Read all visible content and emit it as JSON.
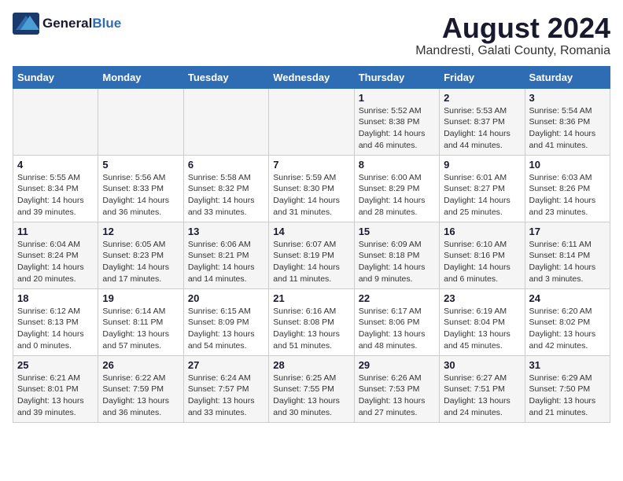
{
  "logo": {
    "general": "General",
    "blue": "Blue"
  },
  "title": "August 2024",
  "subtitle": "Mandresti, Galati County, Romania",
  "days_of_week": [
    "Sunday",
    "Monday",
    "Tuesday",
    "Wednesday",
    "Thursday",
    "Friday",
    "Saturday"
  ],
  "weeks": [
    [
      {
        "day": "",
        "info": ""
      },
      {
        "day": "",
        "info": ""
      },
      {
        "day": "",
        "info": ""
      },
      {
        "day": "",
        "info": ""
      },
      {
        "day": "1",
        "info": "Sunrise: 5:52 AM\nSunset: 8:38 PM\nDaylight: 14 hours and 46 minutes."
      },
      {
        "day": "2",
        "info": "Sunrise: 5:53 AM\nSunset: 8:37 PM\nDaylight: 14 hours and 44 minutes."
      },
      {
        "day": "3",
        "info": "Sunrise: 5:54 AM\nSunset: 8:36 PM\nDaylight: 14 hours and 41 minutes."
      }
    ],
    [
      {
        "day": "4",
        "info": "Sunrise: 5:55 AM\nSunset: 8:34 PM\nDaylight: 14 hours and 39 minutes."
      },
      {
        "day": "5",
        "info": "Sunrise: 5:56 AM\nSunset: 8:33 PM\nDaylight: 14 hours and 36 minutes."
      },
      {
        "day": "6",
        "info": "Sunrise: 5:58 AM\nSunset: 8:32 PM\nDaylight: 14 hours and 33 minutes."
      },
      {
        "day": "7",
        "info": "Sunrise: 5:59 AM\nSunset: 8:30 PM\nDaylight: 14 hours and 31 minutes."
      },
      {
        "day": "8",
        "info": "Sunrise: 6:00 AM\nSunset: 8:29 PM\nDaylight: 14 hours and 28 minutes."
      },
      {
        "day": "9",
        "info": "Sunrise: 6:01 AM\nSunset: 8:27 PM\nDaylight: 14 hours and 25 minutes."
      },
      {
        "day": "10",
        "info": "Sunrise: 6:03 AM\nSunset: 8:26 PM\nDaylight: 14 hours and 23 minutes."
      }
    ],
    [
      {
        "day": "11",
        "info": "Sunrise: 6:04 AM\nSunset: 8:24 PM\nDaylight: 14 hours and 20 minutes."
      },
      {
        "day": "12",
        "info": "Sunrise: 6:05 AM\nSunset: 8:23 PM\nDaylight: 14 hours and 17 minutes."
      },
      {
        "day": "13",
        "info": "Sunrise: 6:06 AM\nSunset: 8:21 PM\nDaylight: 14 hours and 14 minutes."
      },
      {
        "day": "14",
        "info": "Sunrise: 6:07 AM\nSunset: 8:19 PM\nDaylight: 14 hours and 11 minutes."
      },
      {
        "day": "15",
        "info": "Sunrise: 6:09 AM\nSunset: 8:18 PM\nDaylight: 14 hours and 9 minutes."
      },
      {
        "day": "16",
        "info": "Sunrise: 6:10 AM\nSunset: 8:16 PM\nDaylight: 14 hours and 6 minutes."
      },
      {
        "day": "17",
        "info": "Sunrise: 6:11 AM\nSunset: 8:14 PM\nDaylight: 14 hours and 3 minutes."
      }
    ],
    [
      {
        "day": "18",
        "info": "Sunrise: 6:12 AM\nSunset: 8:13 PM\nDaylight: 14 hours and 0 minutes."
      },
      {
        "day": "19",
        "info": "Sunrise: 6:14 AM\nSunset: 8:11 PM\nDaylight: 13 hours and 57 minutes."
      },
      {
        "day": "20",
        "info": "Sunrise: 6:15 AM\nSunset: 8:09 PM\nDaylight: 13 hours and 54 minutes."
      },
      {
        "day": "21",
        "info": "Sunrise: 6:16 AM\nSunset: 8:08 PM\nDaylight: 13 hours and 51 minutes."
      },
      {
        "day": "22",
        "info": "Sunrise: 6:17 AM\nSunset: 8:06 PM\nDaylight: 13 hours and 48 minutes."
      },
      {
        "day": "23",
        "info": "Sunrise: 6:19 AM\nSunset: 8:04 PM\nDaylight: 13 hours and 45 minutes."
      },
      {
        "day": "24",
        "info": "Sunrise: 6:20 AM\nSunset: 8:02 PM\nDaylight: 13 hours and 42 minutes."
      }
    ],
    [
      {
        "day": "25",
        "info": "Sunrise: 6:21 AM\nSunset: 8:01 PM\nDaylight: 13 hours and 39 minutes."
      },
      {
        "day": "26",
        "info": "Sunrise: 6:22 AM\nSunset: 7:59 PM\nDaylight: 13 hours and 36 minutes."
      },
      {
        "day": "27",
        "info": "Sunrise: 6:24 AM\nSunset: 7:57 PM\nDaylight: 13 hours and 33 minutes."
      },
      {
        "day": "28",
        "info": "Sunrise: 6:25 AM\nSunset: 7:55 PM\nDaylight: 13 hours and 30 minutes."
      },
      {
        "day": "29",
        "info": "Sunrise: 6:26 AM\nSunset: 7:53 PM\nDaylight: 13 hours and 27 minutes."
      },
      {
        "day": "30",
        "info": "Sunrise: 6:27 AM\nSunset: 7:51 PM\nDaylight: 13 hours and 24 minutes."
      },
      {
        "day": "31",
        "info": "Sunrise: 6:29 AM\nSunset: 7:50 PM\nDaylight: 13 hours and 21 minutes."
      }
    ]
  ]
}
